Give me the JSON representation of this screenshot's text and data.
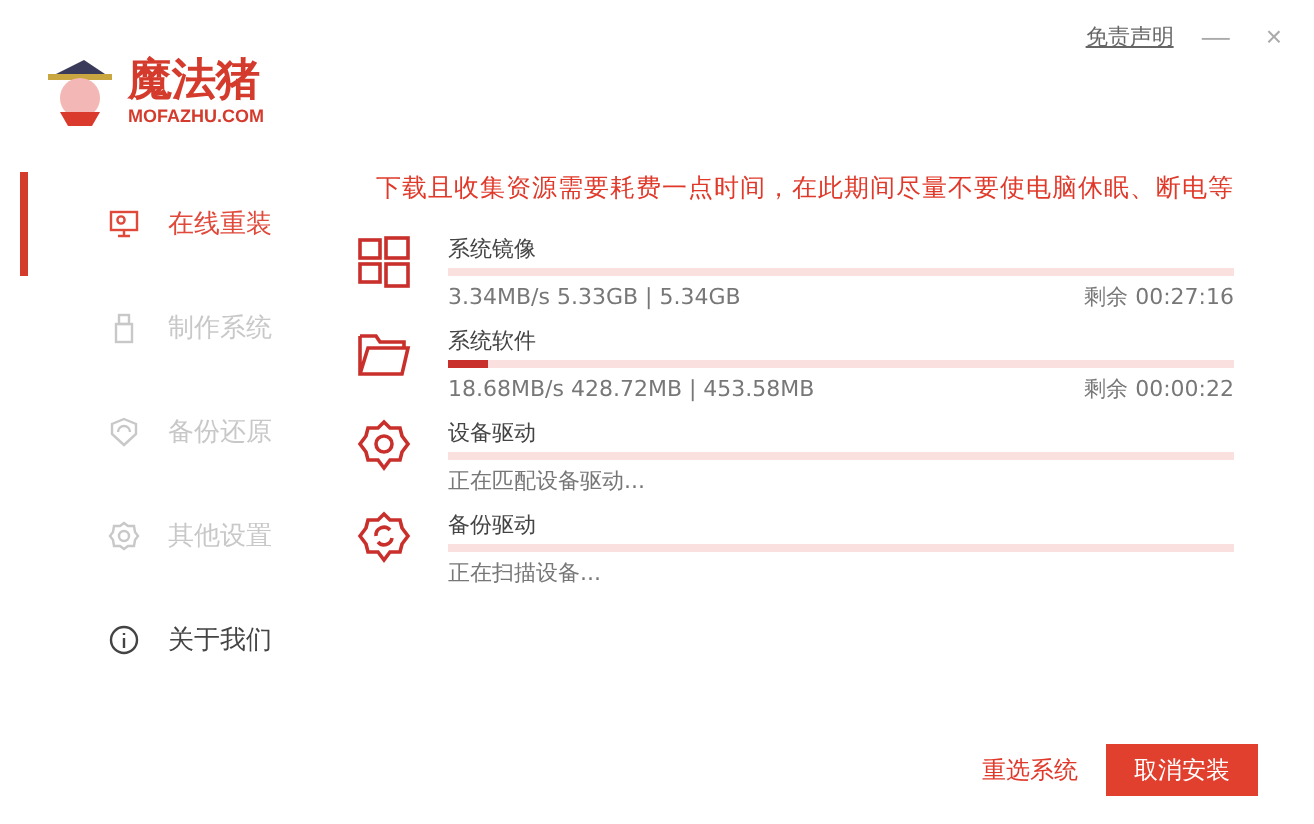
{
  "logo": {
    "name": "魔法猪",
    "domain": "MOFAZHU.COM"
  },
  "window_controls": {
    "disclaimer": "免责声明",
    "minimize": "—",
    "close": "×"
  },
  "sidebar": {
    "items": [
      {
        "label": "在线重装",
        "selected": true,
        "disabled": false
      },
      {
        "label": "制作系统",
        "selected": false,
        "disabled": true
      },
      {
        "label": "备份还原",
        "selected": false,
        "disabled": true
      },
      {
        "label": "其他设置",
        "selected": false,
        "disabled": true
      },
      {
        "label": "关于我们",
        "selected": false,
        "disabled": false
      }
    ]
  },
  "notice": "下载且收集资源需要耗费一点时间，在此期间尽量不要使电脑休眠、断电等",
  "tasks": [
    {
      "title": "系统镜像",
      "level": 0,
      "status": "3.34MB/s 5.33GB | 5.34GB",
      "remaining": "剩余 00:27:16"
    },
    {
      "title": "系统软件",
      "level": 0.05,
      "status": "18.68MB/s 428.72MB | 453.58MB",
      "remaining": "剩余 00:00:22"
    },
    {
      "title": "设备驱动",
      "level": 0,
      "status": "正在匹配设备驱动..."
    },
    {
      "title": "备份驱动",
      "level": 0,
      "status": "正在扫描设备..."
    }
  ],
  "buttons": {
    "reselect": "重选系统",
    "cancel": "取消安装"
  }
}
